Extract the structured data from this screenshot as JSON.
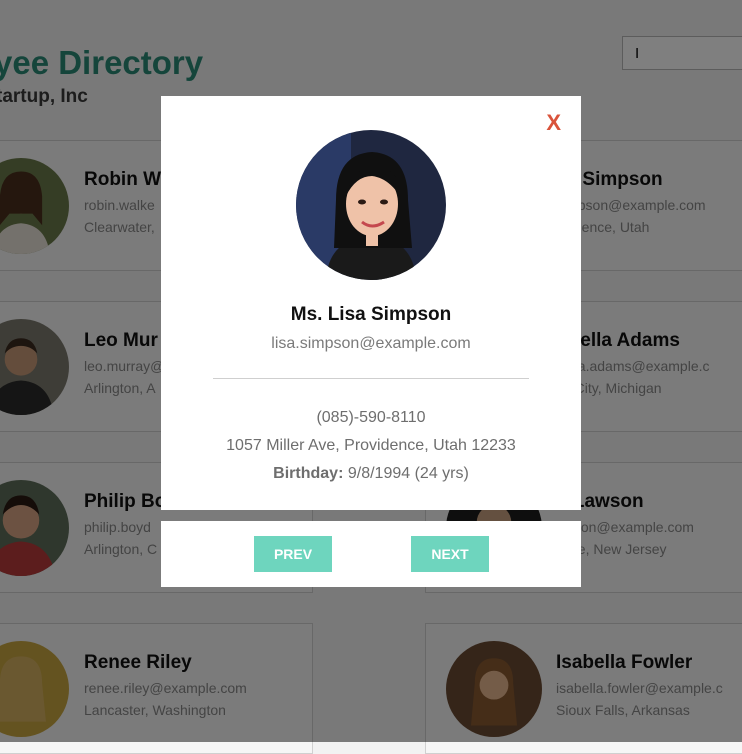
{
  "header": {
    "title": "yee Directory",
    "subtitle": "tartup, Inc"
  },
  "search": {
    "value": "I"
  },
  "employees": [
    {
      "name": "Robin W",
      "email": "robin.walke",
      "location": "Clearwater,"
    },
    {
      "name": "sa Simpson",
      "email": "simpson@example.com",
      "location": "ovidence, Utah"
    },
    {
      "name": "Leo Mur",
      "email": "leo.murray@",
      "location": "Arlington, A"
    },
    {
      "name": "briella Adams",
      "email": "riella.adams@example.c",
      "location": "ey City, Michigan"
    },
    {
      "name": "Philip Bo",
      "email": "philip.boyd",
      "location": "Arlington, C"
    },
    {
      "name": "n Lawson",
      "email": "awson@example.com",
      "location": "Jose, New Jersey"
    },
    {
      "name": "Renee Riley",
      "email": "renee.riley@example.com",
      "location": "Lancaster, Washington"
    },
    {
      "name": "Isabella Fowler",
      "email": "isabella.fowler@example.c",
      "location": "Sioux Falls, Arkansas"
    }
  ],
  "modal": {
    "close_label": "X",
    "name": "Ms. Lisa Simpson",
    "email": "lisa.simpson@example.com",
    "phone": "(085)-590-8110",
    "address": "1057 Miller Ave, Providence, Utah 12233",
    "birthday_label": "Birthday:",
    "birthday_value": "9/8/1994 (24 yrs)"
  },
  "nav": {
    "prev_label": "PREV",
    "next_label": "NEXT"
  },
  "colors": {
    "accent": "#2b8a77",
    "button": "#6ed5be",
    "close": "#d9533b"
  }
}
